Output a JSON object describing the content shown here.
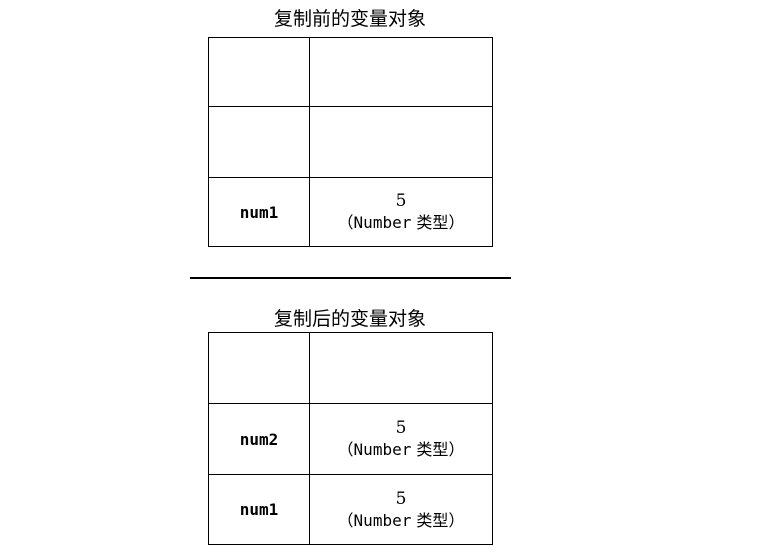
{
  "before": {
    "title": "复制前的变量对象",
    "rows": [
      {
        "name": "",
        "value": "",
        "type_open": "",
        "type_name": "",
        "type_suffix": "",
        "type_close": ""
      },
      {
        "name": "",
        "value": "",
        "type_open": "",
        "type_name": "",
        "type_suffix": "",
        "type_close": ""
      },
      {
        "name": "num1",
        "value": "5",
        "type_open": "（",
        "type_name": "Number",
        "type_suffix": " 类型",
        "type_close": "）"
      }
    ]
  },
  "after": {
    "title": "复制后的变量对象",
    "rows": [
      {
        "name": "",
        "value": "",
        "type_open": "",
        "type_name": "",
        "type_suffix": "",
        "type_close": ""
      },
      {
        "name": "num2",
        "value": "5",
        "type_open": "（",
        "type_name": "Number",
        "type_suffix": " 类型",
        "type_close": "）"
      },
      {
        "name": "num1",
        "value": "5",
        "type_open": "（",
        "type_name": "Number",
        "type_suffix": " 类型",
        "type_close": "）"
      }
    ]
  }
}
